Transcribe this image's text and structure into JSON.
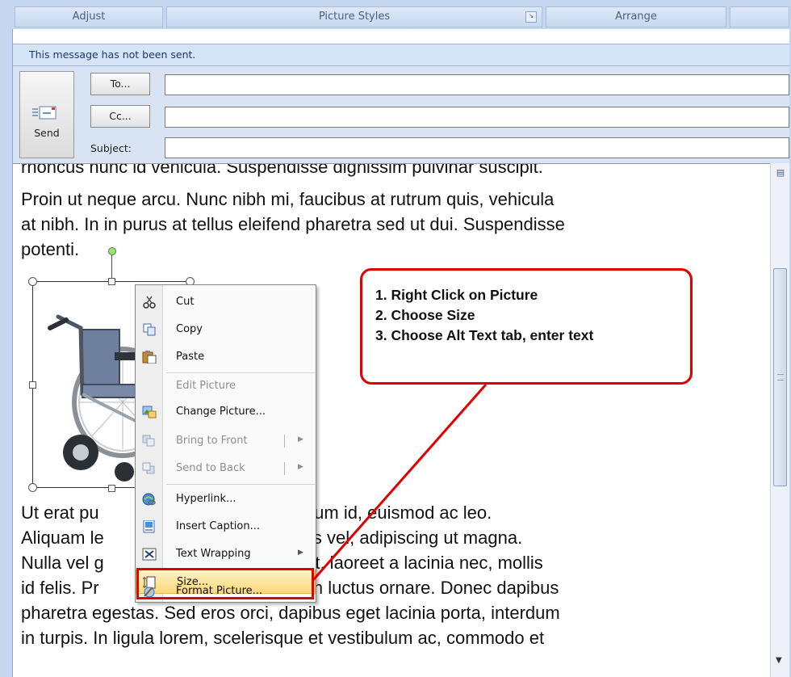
{
  "ribbon": {
    "groups": [
      {
        "label": "Adjust"
      },
      {
        "label": "Picture Styles",
        "launcher": "dialog-launcher"
      },
      {
        "label": "Arrange"
      }
    ]
  },
  "infobar": {
    "text": "This message has not been sent."
  },
  "header": {
    "send_label": "Send",
    "to_label": "To...",
    "cc_label": "Cc...",
    "subject_label": "Subject:",
    "to_value": "",
    "cc_value": "",
    "subject_value": ""
  },
  "body": {
    "para_top_cut": "rhoncus nunc id vehicula. Suspendisse dignissim pulvinar suscipit.",
    "para1": "Proin ut neque arcu. Nunc nibh mi, faucibus at rutrum quis, vehicula\nat nibh. In in purus at tellus eleifend pharetra sed ut dui. Suspendisse\npotenti.",
    "para2": "Ut erat pu                         t condimentum id, euismod ac leo.\nAliquam le                          ac faucibus vel, adipiscing ut magna.\nNulla vel g                          is tellus est, laoreet a lacinia nec, mollis\nid felis. Pr                          cus eu diam luctus ornare. Donec dapibus\npharetra egestas. Sed eros orci, dapibus eget lacinia porta, interdum\nin turpis. In ligula lorem, scelerisque et vestibulum ac, commodo et"
  },
  "context_menu": {
    "items": [
      {
        "label": "Cut",
        "icon": "scissors-icon",
        "enabled": true
      },
      {
        "label": "Copy",
        "icon": "copy-icon",
        "enabled": true
      },
      {
        "label": "Paste",
        "icon": "paste-icon",
        "enabled": true
      },
      {
        "label": "Edit Picture",
        "icon": "",
        "enabled": false
      },
      {
        "label": "Change Picture...",
        "icon": "change-picture-icon",
        "enabled": true
      },
      {
        "label": "Bring to Front",
        "icon": "bring-to-front-icon",
        "enabled": false,
        "submenu": true
      },
      {
        "label": "Send to Back",
        "icon": "send-to-back-icon",
        "enabled": false,
        "submenu": true
      },
      {
        "label": "Hyperlink...",
        "icon": "hyperlink-icon",
        "enabled": true
      },
      {
        "label": "Insert Caption...",
        "icon": "insert-caption-icon",
        "enabled": true
      },
      {
        "label": "Text Wrapping",
        "icon": "text-wrapping-icon",
        "enabled": true,
        "submenu": true
      },
      {
        "label": "Size...",
        "icon": "size-icon",
        "enabled": true,
        "highlighted": true
      },
      {
        "label": "Format Picture...",
        "icon": "format-picture-icon",
        "enabled": true
      }
    ]
  },
  "callout": {
    "lines": [
      "1. Right Click on Picture",
      "2. Choose Size",
      "3. Choose Alt Text tab, enter text"
    ]
  },
  "colors": {
    "annotation_red": "#e00000",
    "ribbon_blue": "#c5d6ee",
    "highlight": "#fcd979"
  }
}
